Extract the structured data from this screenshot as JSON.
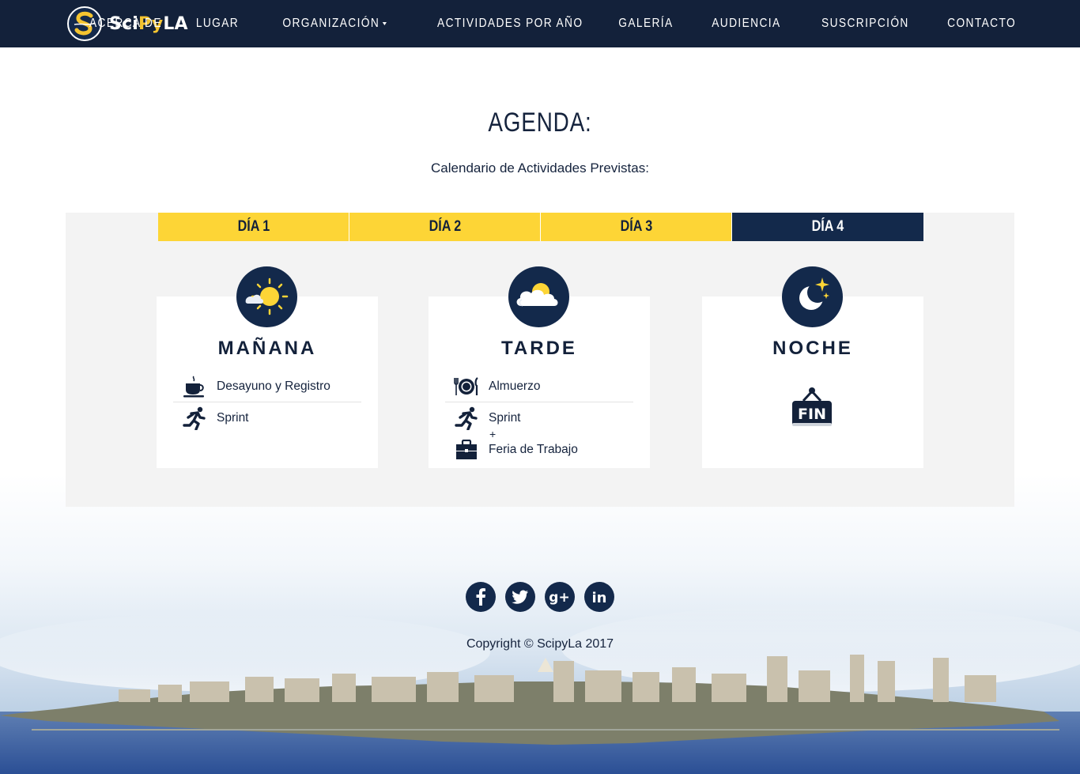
{
  "brand": {
    "name_sci": "Sci",
    "name_py": "Py",
    "name_la": "LA"
  },
  "nav": [
    {
      "label": "Acerca de"
    },
    {
      "label": "Lugar"
    },
    {
      "label": "Organización"
    },
    {
      "label": "Actividades por año"
    },
    {
      "label": "Galería"
    },
    {
      "label": "Audiencia"
    },
    {
      "label": "Suscripción"
    },
    {
      "label": "Contacto"
    }
  ],
  "agenda": {
    "title": "AGENDA:",
    "subtitle": "Calendario de Actividades Previstas:",
    "tabs": [
      {
        "label": "DÍA 1",
        "active": false
      },
      {
        "label": "DÍA 2",
        "active": false
      },
      {
        "label": "DÍA 3",
        "active": false
      },
      {
        "label": "DÍA 4",
        "active": true
      }
    ],
    "cards": [
      {
        "title": "MAÑANA",
        "icon": "sun-cloud-icon",
        "items": [
          {
            "icon": "coffee-cup-icon",
            "label": "Desayuno y Registro"
          },
          {
            "icon": "runner-icon",
            "label": "Sprint"
          }
        ]
      },
      {
        "title": "TARDE",
        "icon": "cloud-sun-icon",
        "items": [
          {
            "icon": "plate-cutlery-icon",
            "label": "Almuerzo"
          },
          {
            "icon": "runner-icon",
            "label": "Sprint"
          },
          {
            "icon": "briefcase-icon",
            "label": "Feria de Trabajo"
          }
        ],
        "plus": "+"
      },
      {
        "title": "NOCHE",
        "icon": "moon-stars-icon",
        "sign": "FIN"
      }
    ]
  },
  "footer": {
    "socials": [
      "facebook-icon",
      "twitter-icon",
      "google-plus-icon",
      "linkedin-icon"
    ],
    "copyright": "Copyright © ScipyLa 2017"
  },
  "colors": {
    "navy": "#13213a",
    "accent_yellow": "#fdd536",
    "active_tab": "#13294b",
    "panel_bg": "#f3f3f3"
  }
}
